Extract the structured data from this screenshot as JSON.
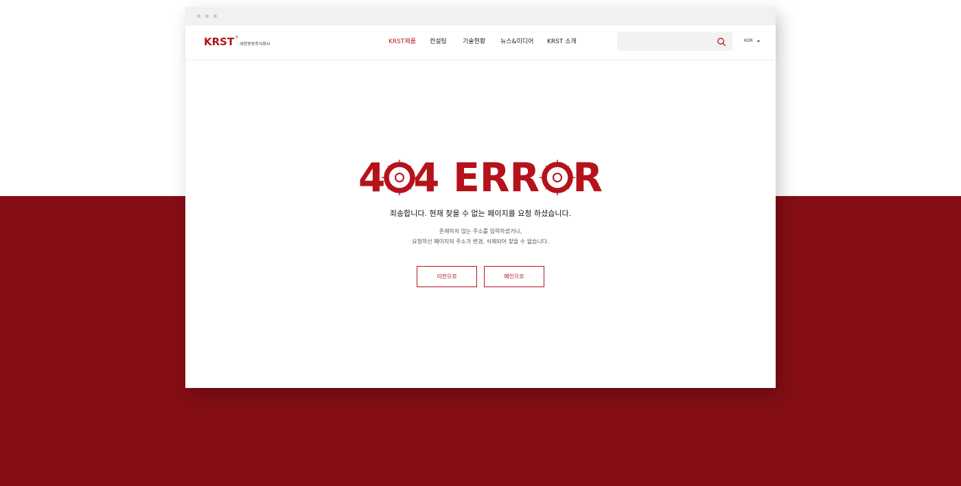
{
  "brand": {
    "logo": "KRST",
    "registered": "®",
    "company": "대한동방주식회사",
    "accent_color": "#b5121b",
    "background_color": "#840e14"
  },
  "nav": {
    "items": [
      "KRST제품",
      "컨설팅",
      "기술현황",
      "뉴스&미디어",
      "KRST 소개"
    ],
    "active_index": 0
  },
  "search": {
    "placeholder": "",
    "icon": "search-icon"
  },
  "language": {
    "label": "KOR",
    "icon": "caret-down-icon"
  },
  "error": {
    "code_text": "404 ERROR",
    "title": "죄송합니다. 현재 찾을 수 없는 페이지를 요청 하셨습니다.",
    "line1": "존재하지 않는 주소를 입력하셨거나,",
    "line2": "요청하신 페이지의 주소가 변경, 삭제되어 찾을 수 없습니다."
  },
  "buttons": {
    "prev": "이전으로",
    "home": "메인으로"
  }
}
